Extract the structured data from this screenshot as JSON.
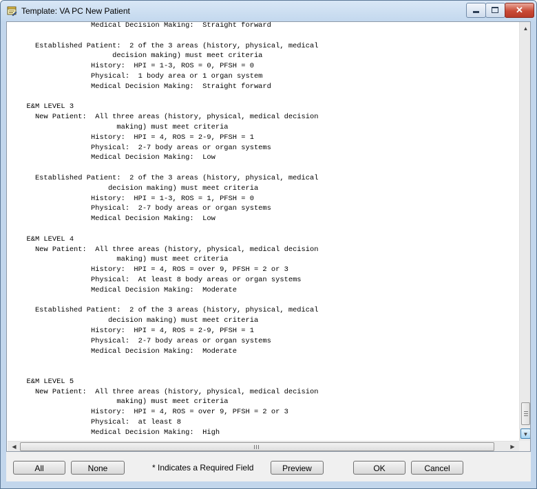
{
  "window": {
    "title": "Template: VA PC New Patient",
    "close_glyph": "✕"
  },
  "content": {
    "lines": [
      "                 Medical Decision Making:  Straight forward",
      "",
      "    Established Patient:  2 of the 3 areas (history, physical, medical",
      "                      decision making) must meet criteria",
      "                 History:  HPI = 1-3, ROS = 0, PFSH = 0",
      "                 Physical:  1 body area or 1 organ system",
      "                 Medical Decision Making:  Straight forward",
      "",
      "  E&M LEVEL 3",
      "    New Patient:  All three areas (history, physical, medical decision",
      "                       making) must meet criteria",
      "                 History:  HPI = 4, ROS = 2-9, PFSH = 1",
      "                 Physical:  2-7 body areas or organ systems",
      "                 Medical Decision Making:  Low",
      "",
      "    Established Patient:  2 of the 3 areas (history, physical, medical",
      "                     decision making) must meet criteria",
      "                 History:  HPI = 1-3, ROS = 1, PFSH = 0",
      "                 Physical:  2-7 body areas or organ systems",
      "                 Medical Decision Making:  Low",
      "",
      "  E&M LEVEL 4",
      "    New Patient:  All three areas (history, physical, medical decision",
      "                       making) must meet criteria",
      "                 History:  HPI = 4, ROS = over 9, PFSH = 2 or 3",
      "                 Physical:  At least 8 body areas or organ systems",
      "                 Medical Decision Making:  Moderate",
      "",
      "    Established Patient:  2 of the 3 areas (history, physical, medical",
      "                     decision making) must meet criteria",
      "                 History:  HPI = 4, ROS = 2-9, PFSH = 1",
      "                 Physical:  2-7 body areas or organ systems",
      "                 Medical Decision Making:  Moderate",
      "",
      "",
      "  E&M LEVEL 5",
      "    New Patient:  All three areas (history, physical, medical decision",
      "                       making) must meet criteria",
      "                 History:  HPI = 4, ROS = over 9, PFSH = 2 or 3",
      "                 Physical:  at least 8",
      "                 Medical Decision Making:  High"
    ]
  },
  "scrollbars": {
    "vertical_position": 0.92,
    "horizontal_position": 0.0,
    "up_glyph": "▲",
    "down_glyph": "▼",
    "left_glyph": "◀",
    "right_glyph": "▶"
  },
  "footer": {
    "all_label": "All",
    "none_label": "None",
    "required_note": "* Indicates a Required Field",
    "preview_label": "Preview",
    "ok_label": "OK",
    "cancel_label": "Cancel"
  },
  "icons": {
    "title": "template-icon",
    "minimize": "minimize-icon",
    "maximize": "maximize-icon",
    "close": "close-icon"
  },
  "colors": {
    "title_bar": "#c3d8ee",
    "close_button": "#c94a36",
    "dialog_face": "#f0f0f0"
  }
}
